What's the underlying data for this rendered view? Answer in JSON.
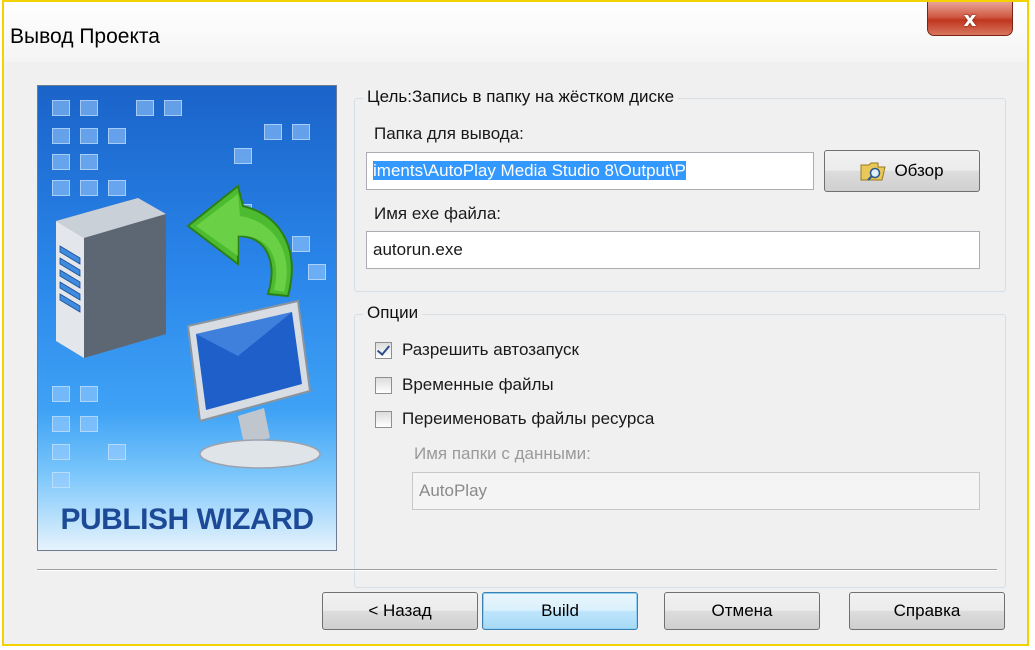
{
  "window": {
    "title": "Вывод Проекта",
    "close_symbol": "x"
  },
  "banner": {
    "label": "PUBLISH WIZARD",
    "icons": [
      "server-icon",
      "arrow-back-icon",
      "monitor-icon"
    ]
  },
  "target": {
    "group_title": "Цель:Запись в папку на жёстком диске",
    "output_folder_label": "Папка для вывода:",
    "output_folder_value": "iments\\AutoPlay Media Studio 8\\Output\\P",
    "browse_label": "Обзор",
    "exe_name_label": "Имя exe файла:",
    "exe_name_value": "autorun.exe"
  },
  "options": {
    "group_title": "Опции",
    "checkboxes": [
      {
        "label": "Разрешить автозапуск",
        "checked": true
      },
      {
        "label": "Временные файлы",
        "checked": false
      },
      {
        "label": "Переименовать файлы ресурса",
        "checked": false
      }
    ],
    "data_folder_label": "Имя папки с данными:",
    "data_folder_value": "AutoPlay"
  },
  "buttons": {
    "back": "< Назад",
    "build": "Build",
    "cancel": "Отмена",
    "help": "Справка"
  },
  "colors": {
    "accent": "#3399ff",
    "window_border": "#f2d200",
    "close_button": "#c0351f"
  }
}
